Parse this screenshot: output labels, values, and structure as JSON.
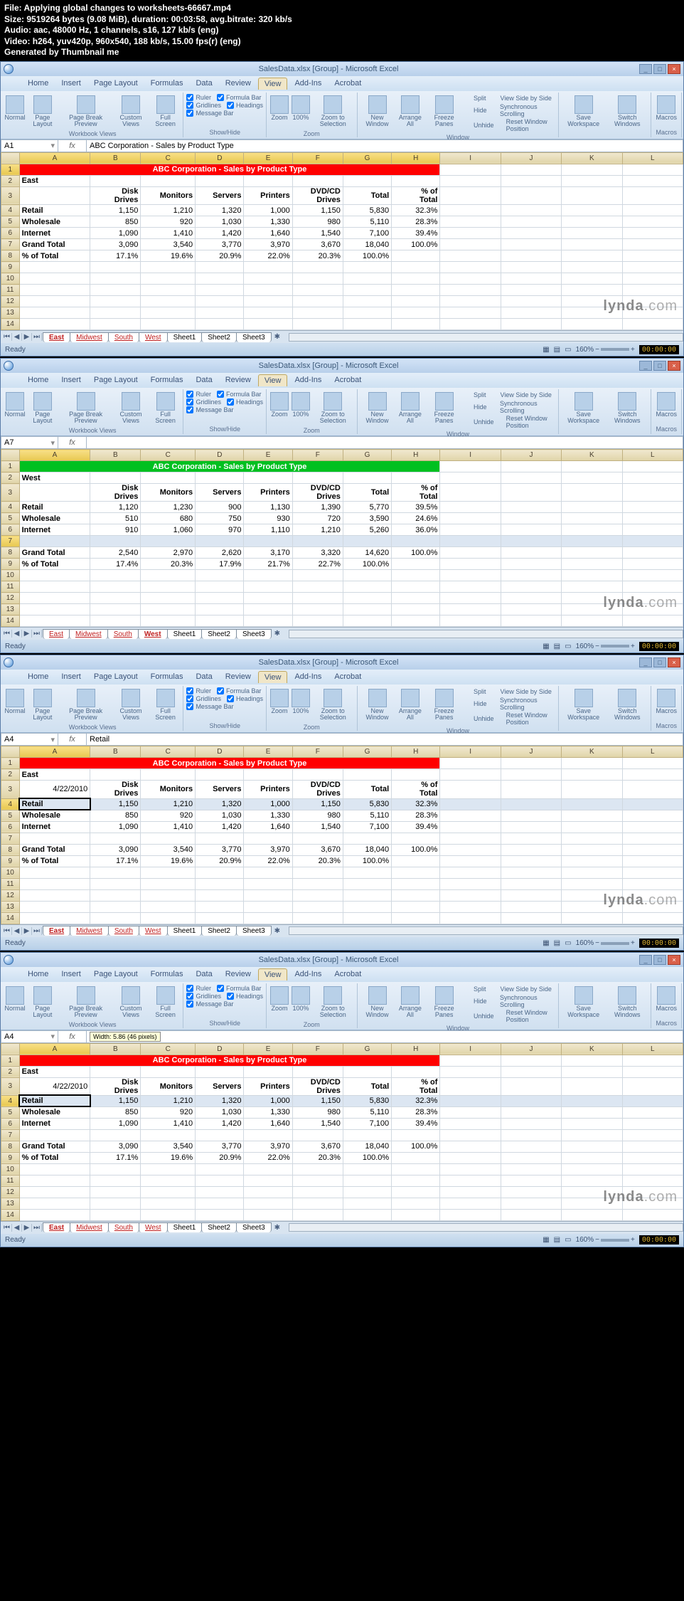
{
  "file_info": [
    "File: Applying global changes to worksheets-66667.mp4",
    "Size: 9519264 bytes (9.08 MiB), duration: 00:03:58, avg.bitrate: 320 kb/s",
    "Audio: aac, 48000 Hz, 1 channels, s16, 127 kb/s (eng)",
    "Video: h264, yuv420p, 960x540, 188 kb/s, 15.00 fps(r) (eng)",
    "Generated by Thumbnail me"
  ],
  "app_title_group": "SalesData.xlsx [Group] - Microsoft Excel",
  "menu": [
    "Home",
    "Insert",
    "Page Layout",
    "Formulas",
    "Data",
    "Review",
    "View",
    "Add-Ins",
    "Acrobat"
  ],
  "active_menu": "View",
  "ribbon": {
    "groups": [
      {
        "label": "Workbook Views",
        "big": [
          {
            "txt": "Normal"
          },
          {
            "txt": "Page Layout"
          },
          {
            "txt": "Page Break Preview"
          },
          {
            "txt": "Custom Views"
          },
          {
            "txt": "Full Screen"
          }
        ]
      },
      {
        "label": "Show/Hide",
        "checks": [
          [
            "Ruler",
            "Formula Bar"
          ],
          [
            "Gridlines",
            "Headings"
          ],
          [
            "Message Bar",
            ""
          ]
        ]
      },
      {
        "label": "Zoom",
        "big": [
          {
            "txt": "Zoom"
          },
          {
            "txt": "100%"
          },
          {
            "txt": "Zoom to Selection"
          }
        ]
      },
      {
        "label": "Window",
        "big": [
          {
            "txt": "New Window"
          },
          {
            "txt": "Arrange All"
          },
          {
            "txt": "Freeze Panes"
          }
        ],
        "small": [
          [
            "Split",
            "View Side by Side"
          ],
          [
            "Hide",
            "Synchronous Scrolling"
          ],
          [
            "Unhide",
            "Reset Window Position"
          ]
        ]
      },
      {
        "label": "",
        "big": [
          {
            "txt": "Save Workspace"
          },
          {
            "txt": "Switch Windows"
          }
        ]
      },
      {
        "label": "Macros",
        "big": [
          {
            "txt": "Macros"
          }
        ]
      }
    ]
  },
  "sheet_tabs_grouped": [
    "East",
    "Midwest",
    "South",
    "West",
    "Sheet1",
    "Sheet2",
    "Sheet3"
  ],
  "columns": [
    "A",
    "B",
    "C",
    "D",
    "E",
    "F",
    "G",
    "H",
    "I",
    "J",
    "K",
    "L"
  ],
  "headers": [
    "",
    "Disk Drives",
    "Monitors",
    "Servers",
    "Printers",
    "DVD/CD Drives",
    "Total",
    "% of Total"
  ],
  "frame1": {
    "namebox": "A1",
    "formula": "ABC Corporation - Sales by Product Type",
    "title": "ABC Corporation - Sales by Product Type",
    "title_color": "red",
    "region": "East",
    "rows": [
      [
        "Retail",
        "1,150",
        "1,210",
        "1,320",
        "1,000",
        "1,150",
        "5,830",
        "32.3%"
      ],
      [
        "Wholesale",
        "850",
        "920",
        "1,030",
        "1,330",
        "980",
        "5,110",
        "28.3%"
      ],
      [
        "Internet",
        "1,090",
        "1,410",
        "1,420",
        "1,640",
        "1,540",
        "7,100",
        "39.4%"
      ],
      [
        "Grand Total",
        "3,090",
        "3,540",
        "3,770",
        "3,970",
        "3,670",
        "18,040",
        "100.0%"
      ],
      [
        "% of Total",
        "17.1%",
        "19.6%",
        "20.9%",
        "22.0%",
        "20.3%",
        "100.0%",
        ""
      ]
    ],
    "active_tab": "East",
    "status": "Ready",
    "zoom": "160%"
  },
  "frame2": {
    "namebox": "A7",
    "formula": "",
    "title": "ABC Corporation - Sales by Product Type",
    "title_color": "green",
    "region": "West",
    "rows": [
      [
        "Retail",
        "1,120",
        "1,230",
        "900",
        "1,130",
        "1,390",
        "5,770",
        "39.5%"
      ],
      [
        "Wholesale",
        "510",
        "680",
        "750",
        "930",
        "720",
        "3,590",
        "24.6%"
      ],
      [
        "Internet",
        "910",
        "1,060",
        "970",
        "1,110",
        "1,210",
        "5,260",
        "36.0%"
      ],
      [
        "",
        "",
        "",
        "",
        "",
        "",
        "",
        ""
      ],
      [
        "Grand Total",
        "2,540",
        "2,970",
        "2,620",
        "3,170",
        "3,320",
        "14,620",
        "100.0%"
      ],
      [
        "% of Total",
        "17.4%",
        "20.3%",
        "17.9%",
        "21.7%",
        "22.7%",
        "100.0%",
        ""
      ]
    ],
    "active_tab": "West",
    "selected_row": 7,
    "status": "Ready",
    "zoom": "160%"
  },
  "frame3": {
    "namebox": "A4",
    "formula": "Retail",
    "title": "ABC Corporation - Sales by Product Type",
    "title_color": "red",
    "region": "East",
    "date": "4/22/2010",
    "rows": [
      [
        "Retail",
        "1,150",
        "1,210",
        "1,320",
        "1,000",
        "1,150",
        "5,830",
        "32.3%"
      ],
      [
        "Wholesale",
        "850",
        "920",
        "1,030",
        "1,330",
        "980",
        "5,110",
        "28.3%"
      ],
      [
        "Internet",
        "1,090",
        "1,410",
        "1,420",
        "1,640",
        "1,540",
        "7,100",
        "39.4%"
      ],
      [
        "",
        "",
        "",
        "",
        "",
        "",
        "",
        ""
      ],
      [
        "Grand Total",
        "3,090",
        "3,540",
        "3,770",
        "3,970",
        "3,670",
        "18,040",
        "100.0%"
      ],
      [
        "% of Total",
        "17.1%",
        "19.6%",
        "20.9%",
        "22.0%",
        "20.3%",
        "100.0%",
        ""
      ]
    ],
    "active_tab": "East",
    "selected_cell": "A4",
    "status": "Ready",
    "zoom": "160%"
  },
  "frame4": {
    "namebox": "A4",
    "formula": "",
    "resize_tip": "Width: 5.86 (46 pixels)",
    "title": "ABC Corporation - Sales by Product Type",
    "title_color": "red",
    "region": "East",
    "date": "4/22/2010",
    "rows": [
      [
        "Retail",
        "1,150",
        "1,210",
        "1,320",
        "1,000",
        "1,150",
        "5,830",
        "32.3%"
      ],
      [
        "Wholesale",
        "850",
        "920",
        "1,030",
        "1,330",
        "980",
        "5,110",
        "28.3%"
      ],
      [
        "Internet",
        "1,090",
        "1,410",
        "1,420",
        "1,640",
        "1,540",
        "7,100",
        "39.4%"
      ],
      [
        "",
        "",
        "",
        "",
        "",
        "",
        "",
        ""
      ],
      [
        "Grand Total",
        "3,090",
        "3,540",
        "3,770",
        "3,970",
        "3,670",
        "18,040",
        "100.0%"
      ],
      [
        "% of Total",
        "17.1%",
        "19.6%",
        "20.9%",
        "22.0%",
        "20.3%",
        "100.0%",
        ""
      ]
    ],
    "active_tab": "East",
    "selected_cell": "A4",
    "status": "Ready",
    "zoom": "160%"
  },
  "watermark": "lynda.com"
}
